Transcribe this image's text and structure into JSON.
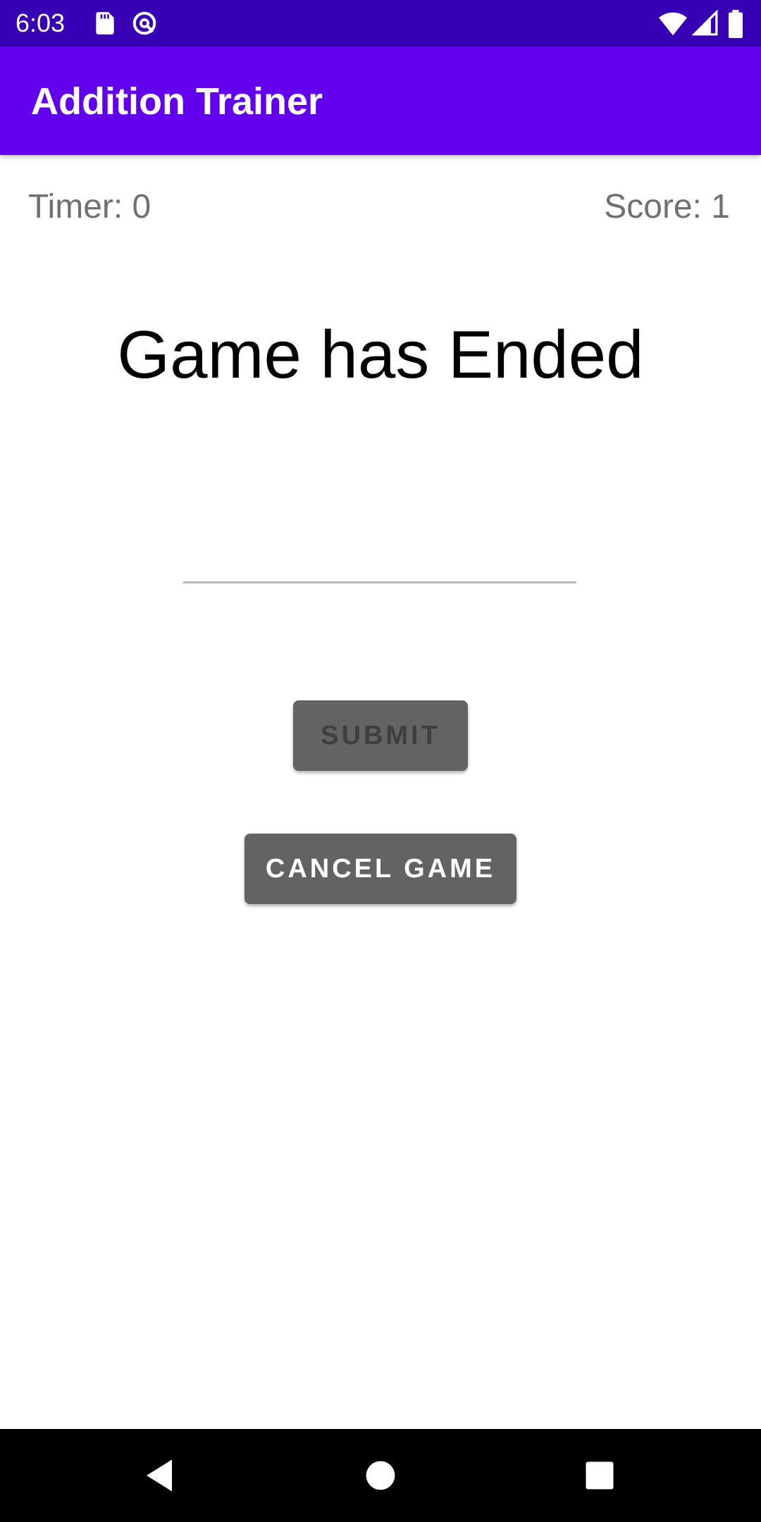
{
  "status_bar": {
    "time": "6:03",
    "icons": [
      "sd-card-icon",
      "data-saver-icon",
      "wifi-icon",
      "signal-icon",
      "battery-icon"
    ],
    "background": "#3700b3"
  },
  "app_bar": {
    "title": "Addition Trainer",
    "background": "#6200ee"
  },
  "game": {
    "timer_label": "Timer: 0",
    "score_label": "Score: 1",
    "question": "Game has Ended",
    "answer_value": "",
    "answer_placeholder": ""
  },
  "buttons": {
    "submit_label": "SUBMIT",
    "cancel_label": "CANCEL GAME",
    "color": "#636363"
  },
  "nav_bar": {
    "icons": [
      "back-icon",
      "home-icon",
      "recents-icon"
    ]
  }
}
